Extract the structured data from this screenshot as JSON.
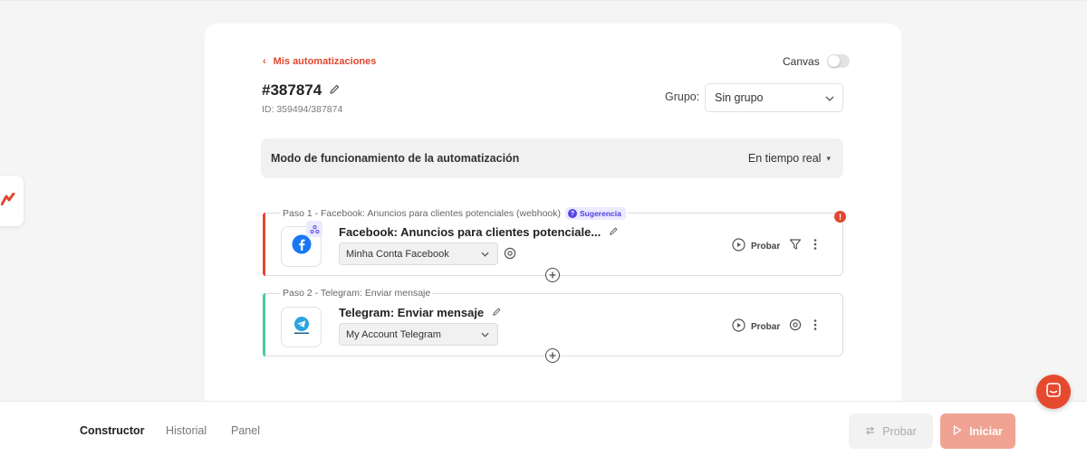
{
  "header": {
    "back_link": "Mis automatizaciones",
    "canvas_label": "Canvas",
    "canvas_enabled": false,
    "title": "#387874",
    "id_text": "ID: 359494/387874",
    "group_label": "Grupo:",
    "group_value": "Sin grupo"
  },
  "mode": {
    "label": "Modo de funcionamiento de la automatización",
    "value": "En tiempo real"
  },
  "steps": [
    {
      "caption": "Paso 1 - Facebook: Anuncios para clientes potenciales (webhook)",
      "badge": "Sugerencia",
      "title": "Facebook: Anuncios para clientes potenciale...",
      "account": "Minha Conta Facebook",
      "probar": "Probar",
      "accent": "#e1472f",
      "icon": "facebook-icon",
      "has_warning": true
    },
    {
      "caption": "Paso 2 - Telegram: Enviar mensaje",
      "title": "Telegram: Enviar mensaje",
      "account": "My Account Telegram",
      "probar": "Probar",
      "accent": "#4cc9a0",
      "icon": "telegram-icon"
    }
  ],
  "footer": {
    "tabs": [
      "Constructor",
      "Historial",
      "Panel"
    ],
    "active_tab": "Constructor",
    "probar": "Probar",
    "iniciar": "Iniciar"
  },
  "colors": {
    "brand": "#e1472f",
    "success_accent": "#4cc9a0",
    "suggestion": "#5543e8"
  }
}
